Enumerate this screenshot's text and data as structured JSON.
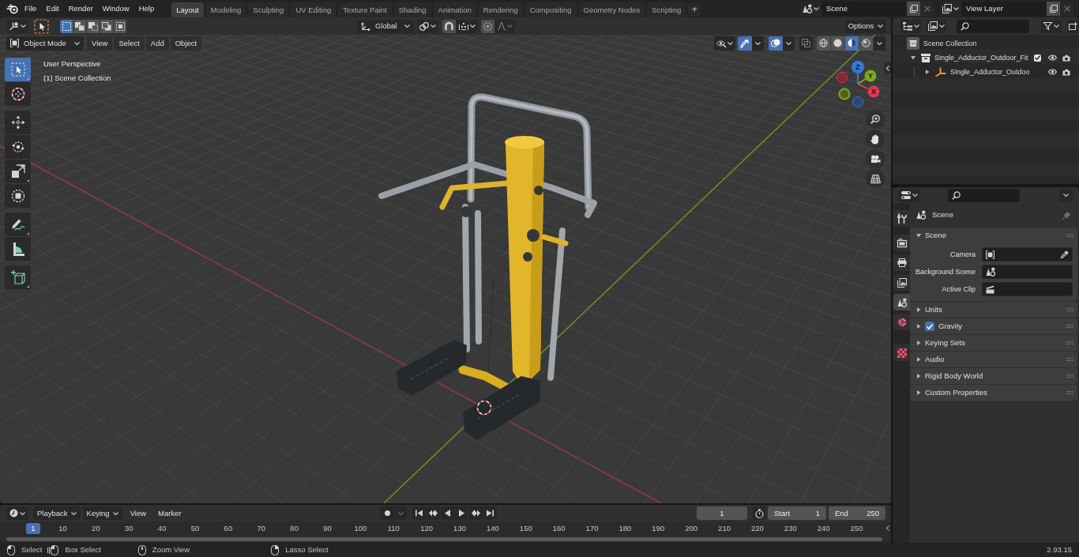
{
  "top_bar": {
    "menus": [
      "File",
      "Edit",
      "Render",
      "Window",
      "Help"
    ],
    "workspaces": [
      {
        "label": "Layout",
        "selected": true
      },
      {
        "label": "Modeling",
        "selected": false
      },
      {
        "label": "Sculpting",
        "selected": false
      },
      {
        "label": "UV Editing",
        "selected": false
      },
      {
        "label": "Texture Paint",
        "selected": false
      },
      {
        "label": "Shading",
        "selected": false
      },
      {
        "label": "Animation",
        "selected": false
      },
      {
        "label": "Rendering",
        "selected": false
      },
      {
        "label": "Compositing",
        "selected": false
      },
      {
        "label": "Geometry Nodes",
        "selected": false
      },
      {
        "label": "Scripting",
        "selected": false
      }
    ],
    "add_workspace": "+",
    "scene": "Scene",
    "view_layer": "View Layer"
  },
  "viewport": {
    "tool_header": {
      "select_modes": [
        {
          "kind": "set",
          "selected": true
        },
        {
          "kind": "extend",
          "selected": false
        },
        {
          "kind": "subtract",
          "selected": false
        },
        {
          "kind": "difference",
          "selected": false
        },
        {
          "kind": "intersect",
          "selected": false
        }
      ],
      "orientation": "Global",
      "snap": false,
      "proportional_editing": false,
      "options": "Options"
    },
    "header": {
      "mode": "Object Mode",
      "menus": [
        "View",
        "Select",
        "Add",
        "Object"
      ],
      "show_gizmos": true,
      "show_overlays": true,
      "xray": false,
      "shading": [
        {
          "kind": "wireframe",
          "selected": false
        },
        {
          "kind": "solid",
          "selected": false
        },
        {
          "kind": "material",
          "selected": true
        },
        {
          "kind": "rendered",
          "selected": false
        }
      ]
    },
    "overlay_text": [
      "User Perspective",
      "(1) Scene Collection"
    ],
    "tools": [
      {
        "kind": "select_box",
        "selected": true
      },
      {
        "kind": "cursor",
        "selected": false
      },
      {
        "kind": "move",
        "selected": false
      },
      {
        "kind": "rotate",
        "selected": false
      },
      {
        "kind": "scale",
        "selected": false
      },
      {
        "kind": "transform",
        "selected": false
      },
      {
        "kind": "annotate",
        "selected": false
      },
      {
        "kind": "measure",
        "selected": false
      },
      {
        "kind": "add_cube",
        "selected": false
      }
    ],
    "axis_labels": [
      "X",
      "Y",
      "Z"
    ]
  },
  "outliner": {
    "items": [
      {
        "label": "Scene Collection",
        "kind": "scene_collection",
        "children": [
          {
            "label": "Single_Adductor_Outdoor_Fit",
            "kind": "collection",
            "expanded": true,
            "checked": true,
            "children": [
              {
                "label": "Single_Adductor_Outdoo",
                "kind": "empty",
                "expanded": false
              }
            ]
          }
        ]
      }
    ]
  },
  "properties": {
    "tabs": [
      {
        "kind": "tool",
        "selected": false
      },
      {
        "kind": "render",
        "selected": false
      },
      {
        "kind": "output",
        "selected": false
      },
      {
        "kind": "view_layer",
        "selected": false
      },
      {
        "kind": "scene",
        "selected": true
      },
      {
        "kind": "world",
        "selected": false
      },
      {
        "kind": "texture",
        "selected": false
      }
    ],
    "context": "Scene",
    "panels": [
      {
        "label": "Scene",
        "expanded": true,
        "fields": [
          {
            "label": "Camera",
            "kind": "camera"
          },
          {
            "label": "Background Scene",
            "kind": "scene"
          },
          {
            "label": "Active Clip",
            "kind": "clip"
          }
        ]
      },
      {
        "label": "Units",
        "expanded": false
      },
      {
        "label": "Gravity",
        "expanded": false,
        "checked": true
      },
      {
        "label": "Keying Sets",
        "expanded": false
      },
      {
        "label": "Audio",
        "expanded": false
      },
      {
        "label": "Rigid Body World",
        "expanded": false
      },
      {
        "label": "Custom Properties",
        "expanded": false
      }
    ]
  },
  "timeline": {
    "menus": [
      {
        "label": "Playback",
        "kind": "dropdown"
      },
      {
        "label": "Keying",
        "kind": "dropdown"
      },
      {
        "label": "View",
        "kind": "menu"
      },
      {
        "label": "Marker",
        "kind": "menu"
      }
    ],
    "auto_keying": false,
    "current_frame": "1",
    "start_label": "Start",
    "start": "1",
    "end_label": "End",
    "end": "250",
    "playhead": "1",
    "frame_labels": [
      "10",
      "20",
      "30",
      "40",
      "50",
      "60",
      "70",
      "80",
      "90",
      "100",
      "110",
      "120",
      "130",
      "140",
      "150",
      "160",
      "170",
      "180",
      "190",
      "200",
      "210",
      "220",
      "230",
      "240",
      "250"
    ]
  },
  "status_bar": {
    "hints": [
      {
        "label": "Select",
        "kind": "left_click"
      },
      {
        "label": "Box Select",
        "kind": "left_drag"
      },
      {
        "label": "Zoom View",
        "kind": "middle"
      },
      {
        "label": "Lasso Select",
        "kind": "right_drag"
      }
    ],
    "version": "2.93.15"
  }
}
